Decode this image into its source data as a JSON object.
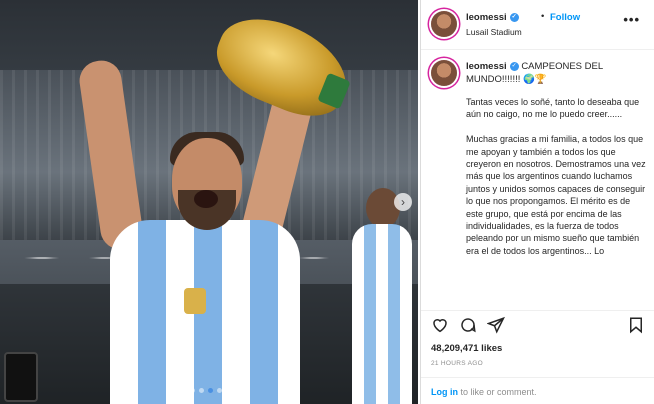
{
  "post": {
    "username": "leomessi",
    "follow_label": "Follow",
    "location": "Lusail Stadium",
    "caption_title": "CAMPEONES DEL MUNDO!!!!!!! 🌍🏆",
    "caption_paragraphs": [
      "Tantas veces lo soñé, tanto lo deseaba que aún no caigo, no me lo puedo creer......",
      "Muchas gracias a mi familia, a todos los que me apoyan y también a todos los que creyeron en nosotros. Demostramos una vez más que los argentinos cuando luchamos juntos y unidos somos capaces de conseguir lo que nos propongamos. El mérito es de este grupo, que está por encima de las individualidades, es la fuerza de todos peleando por un mismo sueño que también era el de todos los argentinos... Lo"
    ],
    "likes": "48,209,471 likes",
    "time_ago": "21 HOURS AGO",
    "login_link": "Log in",
    "login_suffix": " to like or comment."
  },
  "icons": {
    "verified": "verified-badge-icon",
    "more": "more-options-icon",
    "like": "heart-icon",
    "comment": "comment-icon",
    "share": "share-icon",
    "save": "bookmark-icon",
    "next": "chevron-right-icon"
  },
  "colors": {
    "follow": "#0095f6",
    "verified": "#3897f0",
    "muted": "#8e8e8e",
    "text": "#262626"
  }
}
